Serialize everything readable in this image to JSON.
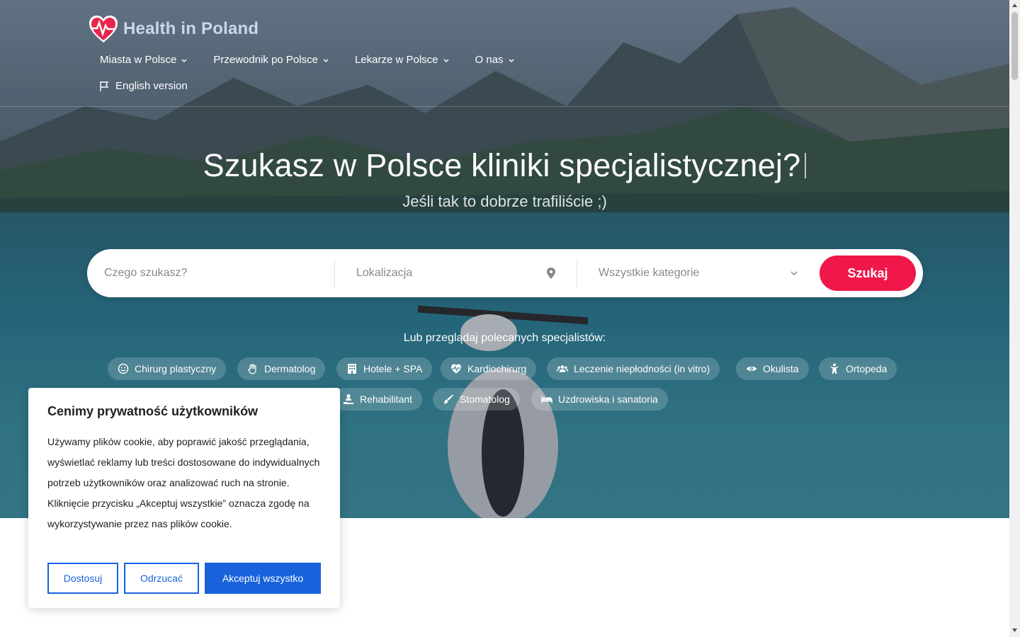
{
  "brand": {
    "name": "Health in Poland",
    "logo_icon": "heart-pulse-icon"
  },
  "nav": {
    "items": [
      {
        "label": "Miasta w Polsce"
      },
      {
        "label": "Przewodnik po Polsce"
      },
      {
        "label": "Lekarze w Polsce"
      },
      {
        "label": "O nas"
      }
    ],
    "english": "English version"
  },
  "hero": {
    "headline": "Szukasz w Polsce kliniki specjalistycznej?",
    "subline": "Jeśli tak to dobrze trafiliście ;)"
  },
  "search": {
    "what_placeholder": "Czego szukasz?",
    "location_placeholder": "Lokalizacja",
    "category_selected": "Wszystkie kategorie",
    "button": "Szukaj"
  },
  "browse": {
    "label": "Lub przeglądaj polecanych specjalistów:",
    "chips": [
      {
        "label": "Chirurg plastyczny",
        "icon": "smile-icon"
      },
      {
        "label": "Dermatolog",
        "icon": "hand-icon"
      },
      {
        "label": "Hotele + SPA",
        "icon": "building-icon"
      },
      {
        "label": "Kardiochirurg",
        "icon": "heartbeat-icon"
      },
      {
        "label": "Leczenie niepłodności (in vitro)",
        "icon": "users-icon"
      },
      {
        "label": "Okulista",
        "icon": "eye-icon"
      },
      {
        "label": "Ortopeda",
        "icon": "person-icon"
      },
      {
        "label": "Rehabilitant",
        "icon": "hand-holding-icon"
      },
      {
        "label": "Stomatolog",
        "icon": "brush-icon"
      },
      {
        "label": "Uzdrowiska i sanatoria",
        "icon": "bed-icon"
      }
    ]
  },
  "cookie": {
    "title": "Cenimy prywatność użytkowników",
    "text": "Używamy plików cookie, aby poprawić jakość przeglądania, wyświetlać reklamy lub treści dostosowane do indywidualnych potrzeb użytkowników oraz analizować ruch na stronie. Kliknięcie przycisku „Akceptuj wszystkie” oznacza zgodę na wykorzystywanie przez nas plików cookie.",
    "customize": "Dostosuj",
    "reject": "Odrzucać",
    "accept": "Akceptuj wszystko"
  },
  "colors": {
    "accent": "#f0184a",
    "cookie_blue": "#1863dc"
  }
}
